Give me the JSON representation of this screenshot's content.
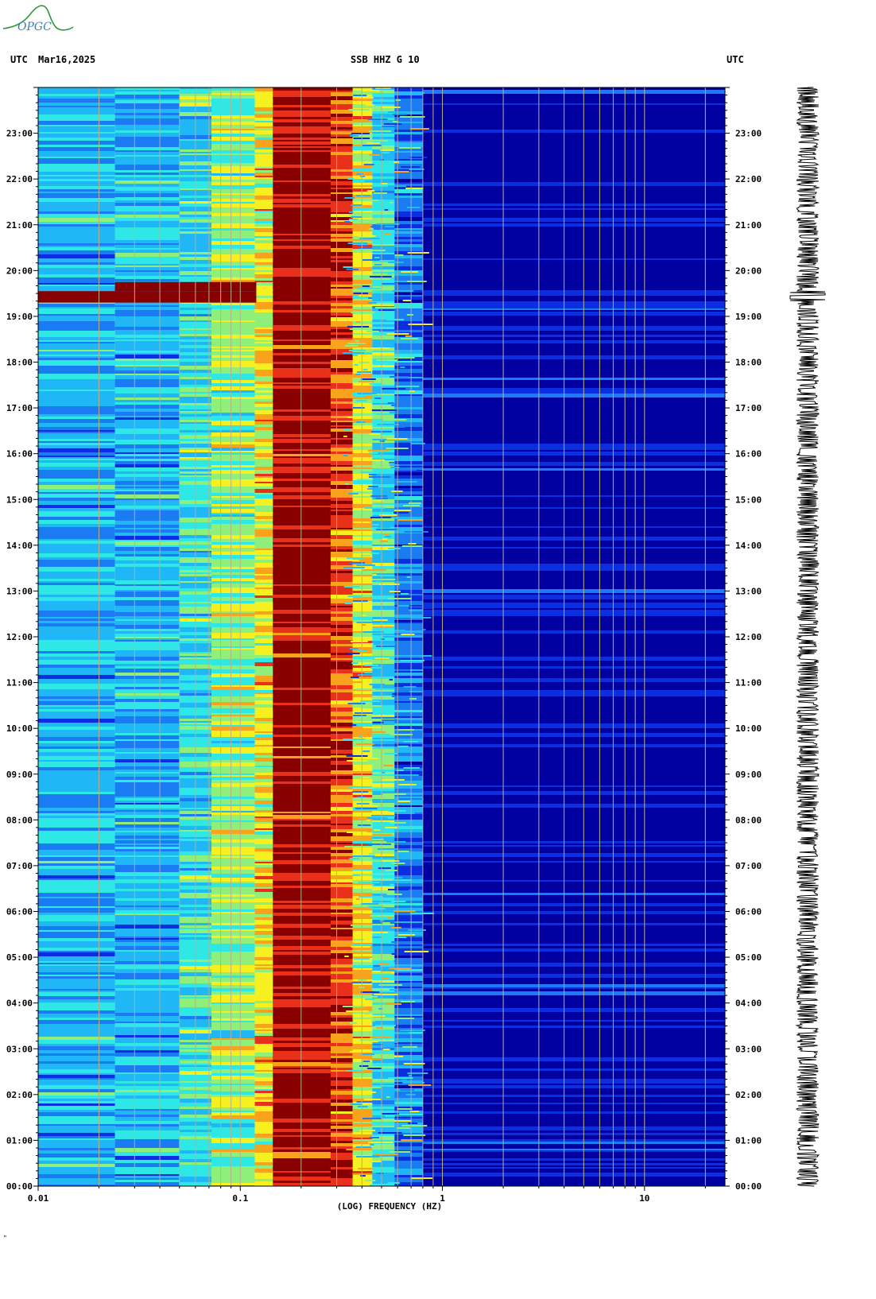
{
  "header": {
    "left_label": "UTC",
    "date": "Mar16,2025",
    "station": "SSB HHZ G 10",
    "right_label": "UTC"
  },
  "logo": {
    "text": "OPGC"
  },
  "footnote": "\"",
  "chart_data": {
    "type": "heatmap",
    "title": "SSB HHZ G 10",
    "xlabel": "(LOG) FREQUENCY (HZ)",
    "x_scale": "log",
    "xlim": [
      0.01,
      25
    ],
    "x_ticks": [
      {
        "value": 0.01,
        "label": "0.01"
      },
      {
        "value": 0.1,
        "label": "0.1"
      },
      {
        "value": 1,
        "label": "1"
      },
      {
        "value": 10,
        "label": "10"
      }
    ],
    "y_hours_range": [
      0,
      24
    ],
    "y_ticks": [
      "00:00",
      "01:00",
      "02:00",
      "03:00",
      "04:00",
      "05:00",
      "06:00",
      "07:00",
      "08:00",
      "09:00",
      "10:00",
      "11:00",
      "12:00",
      "13:00",
      "14:00",
      "15:00",
      "16:00",
      "17:00",
      "18:00",
      "19:00",
      "20:00",
      "21:00",
      "22:00",
      "23:00"
    ],
    "colormap": [
      "#0000a0",
      "#0a2ee0",
      "#1b7bf2",
      "#1fb7f5",
      "#2ee8e6",
      "#8ef07a",
      "#f6f021",
      "#f9a21b",
      "#e8301a",
      "#880000"
    ],
    "frequency_bands": [
      {
        "fmin": 0.01,
        "fmax": 0.024,
        "level": 2.6
      },
      {
        "fmin": 0.024,
        "fmax": 0.05,
        "level": 3.4
      },
      {
        "fmin": 0.05,
        "fmax": 0.072,
        "level": 4.0
      },
      {
        "fmin": 0.072,
        "fmax": 0.118,
        "level": 4.9
      },
      {
        "fmin": 0.118,
        "fmax": 0.145,
        "level": 6.1
      },
      {
        "fmin": 0.145,
        "fmax": 0.28,
        "level": 9.0
      },
      {
        "fmin": 0.28,
        "fmax": 0.36,
        "level": 7.6
      },
      {
        "fmin": 0.36,
        "fmax": 0.45,
        "level": 5.8
      },
      {
        "fmin": 0.45,
        "fmax": 0.58,
        "level": 3.8
      },
      {
        "fmin": 0.58,
        "fmax": 0.8,
        "level": 2.0
      },
      {
        "fmin": 0.8,
        "fmax": 25,
        "level": 0.3
      }
    ],
    "events": [
      {
        "hour_start": 19.3,
        "hour_end": 19.55,
        "fmin": 0.01,
        "fmax": 0.12,
        "level": 8.5
      },
      {
        "hour_start": 19.55,
        "hour_end": 19.75,
        "fmin": 0.024,
        "fmax": 0.12,
        "level": 8.8
      }
    ],
    "seismogram": {
      "label": "seismogram trace",
      "spike_hour": 19.45
    }
  }
}
